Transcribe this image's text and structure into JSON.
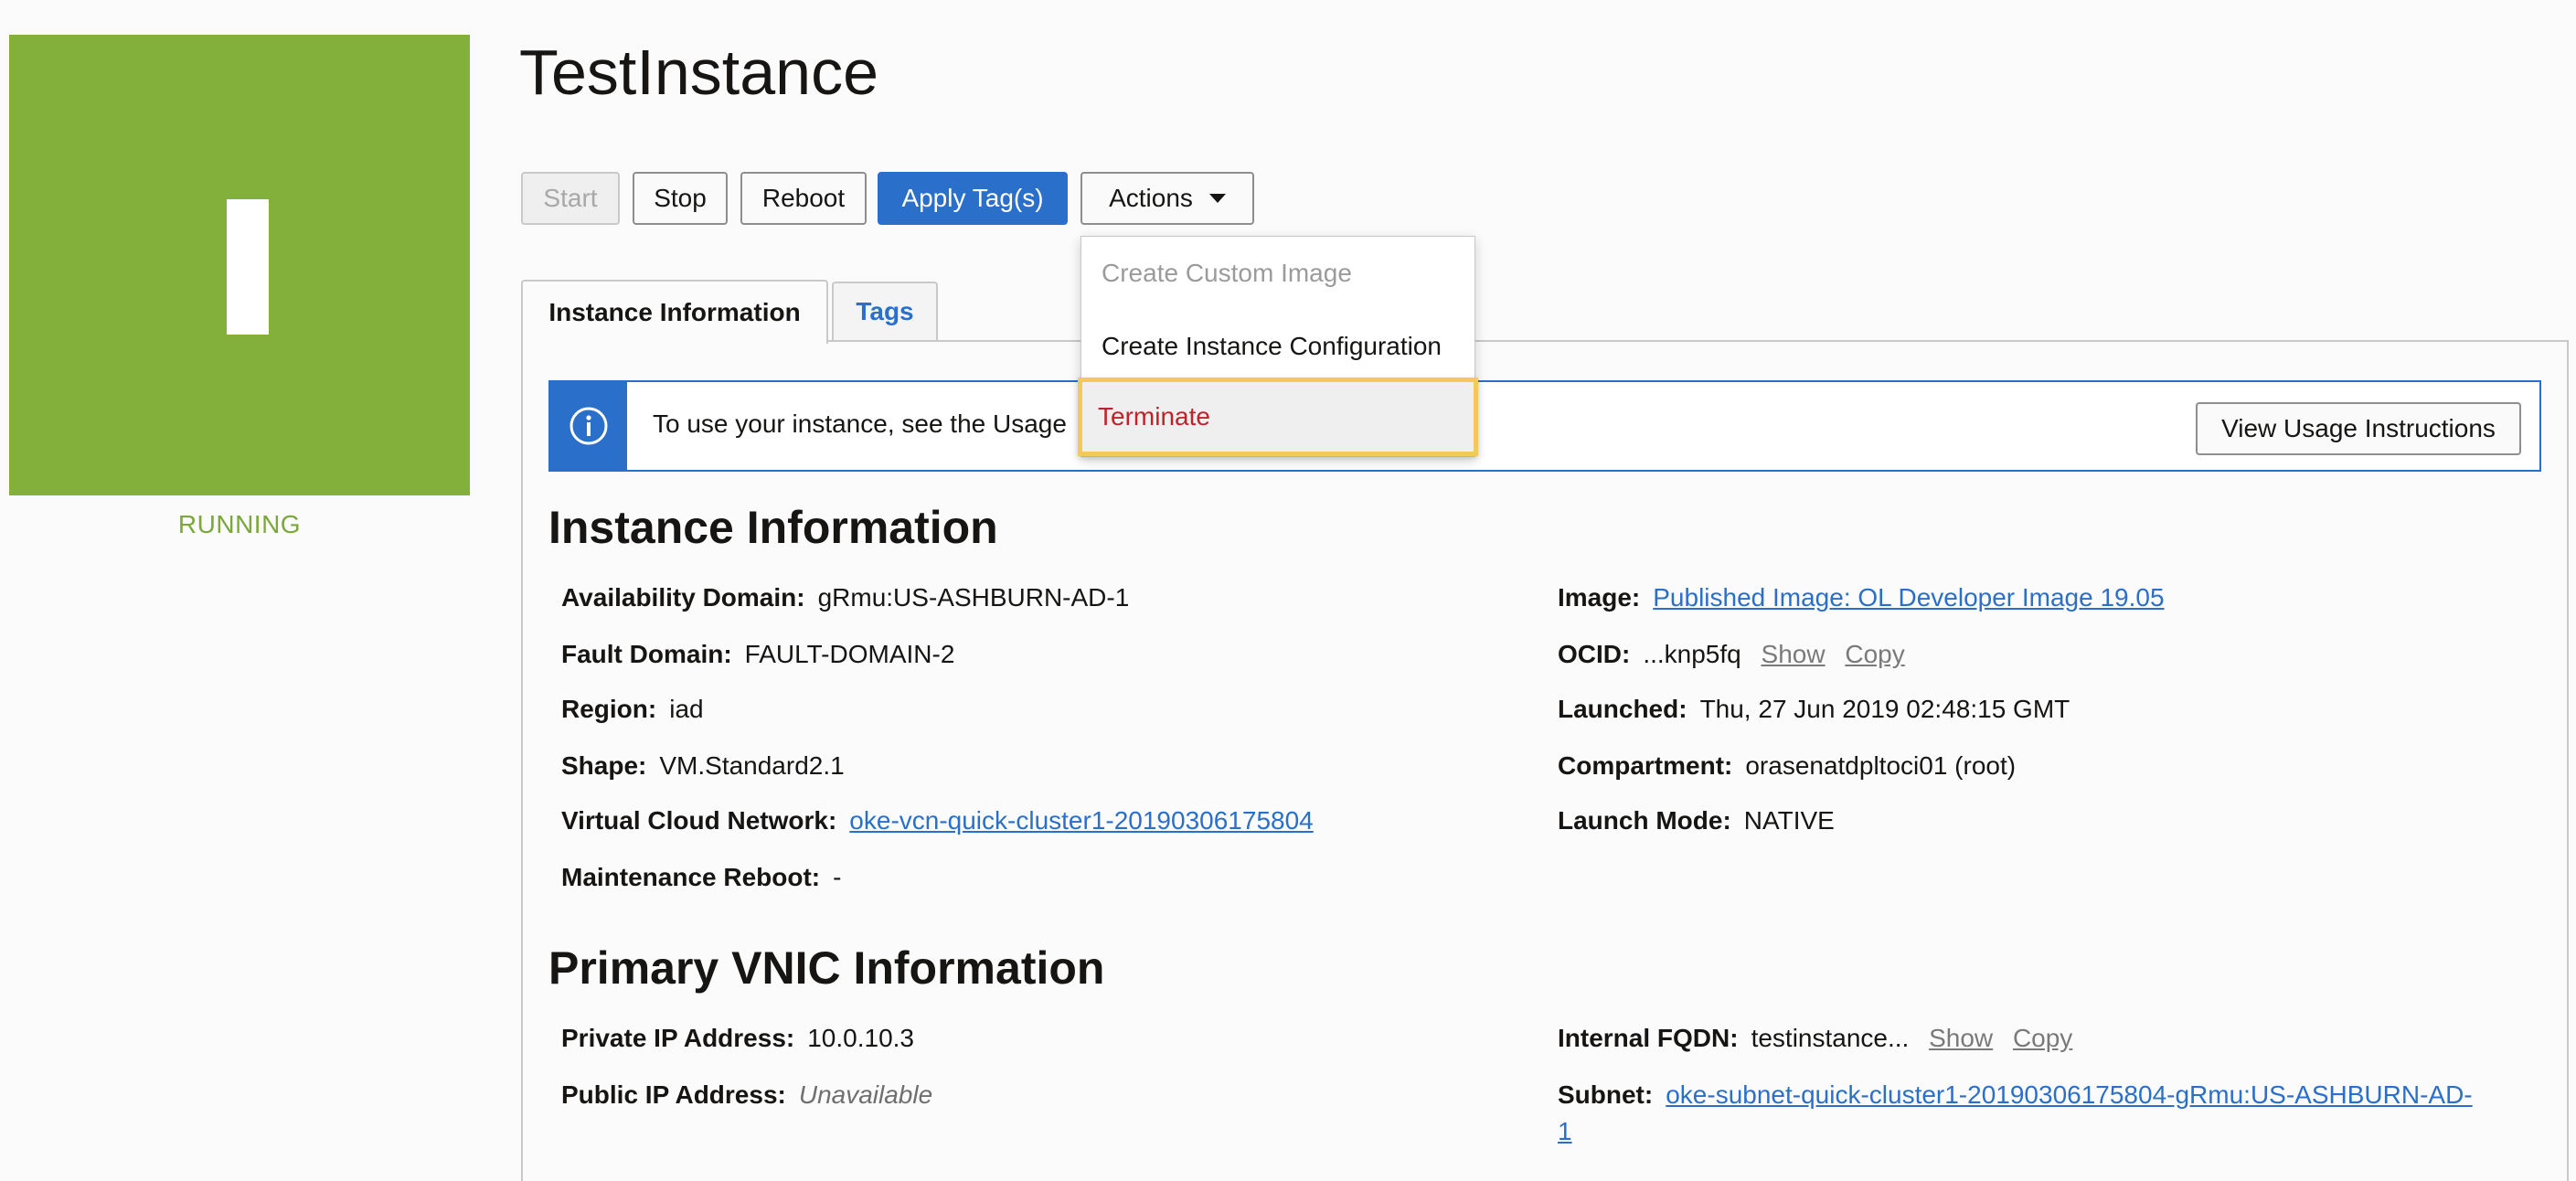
{
  "instance": {
    "status_letter": "I",
    "status": "RUNNING",
    "status_color": "#83b03b",
    "title": "TestInstance"
  },
  "toolbar": {
    "start_label": "Start",
    "stop_label": "Stop",
    "reboot_label": "Reboot",
    "apply_tags_label": "Apply Tag(s)",
    "actions_label": "Actions"
  },
  "actions_menu": {
    "items": [
      {
        "label": "Create Custom Image",
        "state": "disabled"
      },
      {
        "label": "Create Instance Configuration",
        "state": "enabled"
      },
      {
        "label": "Terminate",
        "state": "highlighted"
      }
    ]
  },
  "tabs": [
    {
      "label": "Instance Information",
      "active": true
    },
    {
      "label": "Tags",
      "active": false
    }
  ],
  "banner": {
    "text": "To use your instance, see the Usage",
    "button_label": "View Usage Instructions",
    "icon": "info-icon"
  },
  "instance_info": {
    "heading": "Instance Information",
    "left": [
      {
        "label": "Availability Domain:",
        "value": "gRmu:US-ASHBURN-AD-1"
      },
      {
        "label": "Fault Domain:",
        "value": "FAULT-DOMAIN-2"
      },
      {
        "label": "Region:",
        "value": "iad"
      },
      {
        "label": "Shape:",
        "value": "VM.Standard2.1"
      },
      {
        "label": "Virtual Cloud Network:",
        "value": "oke-vcn-quick-cluster1-20190306175804"
      },
      {
        "label": "Maintenance Reboot:",
        "value": "-"
      }
    ],
    "right": [
      {
        "label": "Image:",
        "value": "Published Image: OL Developer Image 19.05"
      },
      {
        "label": "OCID:",
        "value": "...knp5fq",
        "show": "Show",
        "copy": "Copy"
      },
      {
        "label": "Launched:",
        "value": "Thu, 27 Jun 2019 02:48:15 GMT"
      },
      {
        "label": "Compartment:",
        "value": "orasenatdpltoci01 (root)"
      },
      {
        "label": "Launch Mode:",
        "value": "NATIVE"
      }
    ]
  },
  "vnic_info": {
    "heading": "Primary VNIC Information",
    "left": [
      {
        "label": "Private IP Address:",
        "value": "10.0.10.3"
      },
      {
        "label": "Public IP Address:",
        "value": "Unavailable"
      }
    ],
    "right": [
      {
        "label": "Internal FQDN:",
        "value": "testinstance...",
        "show": "Show",
        "copy": "Copy"
      },
      {
        "label": "Subnet:",
        "value": "oke-subnet-quick-cluster1-20190306175804-gRmu:US-ASHBURN-AD-",
        "value2": "1"
      }
    ]
  }
}
